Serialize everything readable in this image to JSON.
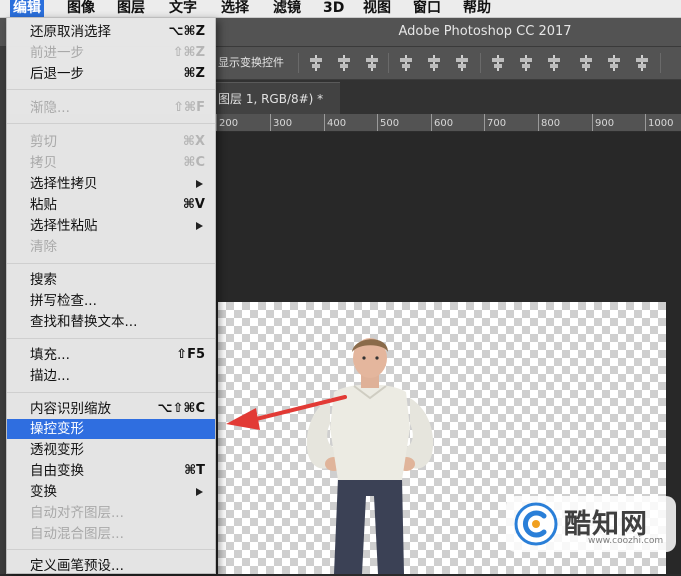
{
  "menubar": {
    "items": [
      "编辑",
      "图像",
      "图层",
      "文字",
      "选择",
      "滤镜",
      "3D",
      "视图",
      "窗口",
      "帮助"
    ],
    "active_index": 0
  },
  "app": {
    "title": "Adobe Photoshop CC 2017"
  },
  "options": {
    "show_transform_controls": "显示变换控件"
  },
  "document": {
    "tab_label": "图层 1, RGB/8#) *"
  },
  "ruler": {
    "ticks": [
      "200",
      "300",
      "400",
      "500",
      "600",
      "700",
      "800",
      "900",
      "1000"
    ]
  },
  "edit_menu": {
    "items": [
      {
        "label": "还原取消选择",
        "shortcut": "⌥⌘Z",
        "enabled": true
      },
      {
        "label": "前进一步",
        "shortcut": "⇧⌘Z",
        "enabled": false
      },
      {
        "label": "后退一步",
        "shortcut": "⌘Z",
        "enabled": true
      },
      {
        "label": "渐隐...",
        "shortcut": "⇧⌘F",
        "enabled": false
      },
      {
        "label": "剪切",
        "shortcut": "⌘X",
        "enabled": false
      },
      {
        "label": "拷贝",
        "shortcut": "⌘C",
        "enabled": false
      },
      {
        "label": "选择性拷贝",
        "shortcut": "",
        "enabled": true,
        "submenu": true
      },
      {
        "label": "粘贴",
        "shortcut": "⌘V",
        "enabled": true
      },
      {
        "label": "选择性粘贴",
        "shortcut": "",
        "enabled": true,
        "submenu": true
      },
      {
        "label": "清除",
        "shortcut": "",
        "enabled": false
      },
      {
        "label": "搜索",
        "shortcut": "",
        "enabled": true
      },
      {
        "label": "拼写检查...",
        "shortcut": "",
        "enabled": true
      },
      {
        "label": "查找和替换文本...",
        "shortcut": "",
        "enabled": true
      },
      {
        "label": "填充...",
        "shortcut": "⇧F5",
        "enabled": true
      },
      {
        "label": "描边...",
        "shortcut": "",
        "enabled": true
      },
      {
        "label": "内容识别缩放",
        "shortcut": "⌥⇧⌘C",
        "enabled": true
      },
      {
        "label": "操控变形",
        "shortcut": "",
        "enabled": true,
        "highlighted": true
      },
      {
        "label": "透视变形",
        "shortcut": "",
        "enabled": true
      },
      {
        "label": "自由变换",
        "shortcut": "⌘T",
        "enabled": true
      },
      {
        "label": "变换",
        "shortcut": "",
        "enabled": true,
        "submenu": true
      },
      {
        "label": "自动对齐图层...",
        "shortcut": "",
        "enabled": false
      },
      {
        "label": "自动混合图层...",
        "shortcut": "",
        "enabled": false
      },
      {
        "label": "定义画笔预设...",
        "shortcut": "",
        "enabled": true
      }
    ]
  },
  "watermark": {
    "brand": "酷知网",
    "url": "www.coozhi.com"
  },
  "colors": {
    "menu_highlight": "#2f6ee0",
    "annotation_arrow": "#e23a35",
    "photoshop_chrome": "#535353"
  }
}
